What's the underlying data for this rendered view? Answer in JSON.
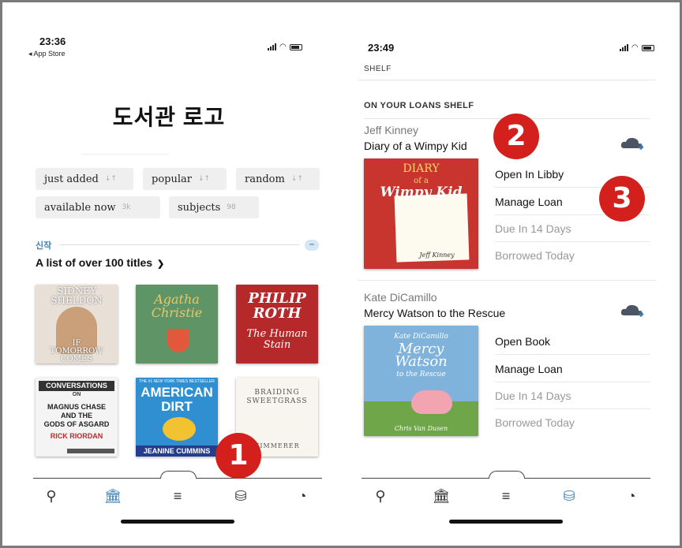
{
  "left_screen": {
    "status_bar": {
      "time": "23:36",
      "back_label": "◂ App Store"
    },
    "library_logo": "도서관 로고",
    "filter_chips": [
      {
        "label": "just added",
        "meta": "↓↑"
      },
      {
        "label": "popular",
        "meta": "↓↑"
      },
      {
        "label": "random",
        "meta": "↓↑"
      },
      {
        "label": "available now",
        "meta": "3k"
      },
      {
        "label": "subjects",
        "meta": "98"
      }
    ],
    "section": {
      "kicker": "신작",
      "collapse_symbol": "–",
      "title": "A list of over 100 titles",
      "title_chevron": "❯"
    },
    "covers": [
      {
        "lines": [
          "SIDNEY",
          "SHELDON"
        ],
        "footer": [
          "IF",
          "TOMORROW",
          "COMES"
        ],
        "bg": "#e8e0d6"
      },
      {
        "lines": [
          "Agatha",
          "Christie"
        ],
        "footer": [],
        "bg": "#5f9466"
      },
      {
        "lines": [
          "PHILIP",
          "ROTH"
        ],
        "footer": [
          "The Human",
          "Stain"
        ],
        "bg": "#b5292a"
      },
      {
        "lines": [
          "CONVERSATIONS",
          "ON"
        ],
        "footer": [
          "MAGNUS CHASE",
          "AND THE",
          "GODS OF ASGARD",
          "RICK RIORDAN"
        ],
        "bg": "#f4f4f4"
      },
      {
        "lines": [
          "THE #1 NEW YORK TIMES BESTSELLER",
          "AMERICAN",
          "DIRT"
        ],
        "footer": [
          "JEANINE CUMMINS"
        ],
        "bg": "#2f8fd1"
      },
      {
        "lines": [
          "BRAIDING",
          "SWEETGRASS"
        ],
        "footer": [
          "KIMMERER"
        ],
        "bg": "#f7f5ee"
      }
    ],
    "tabs": [
      {
        "name": "search",
        "glyph": "⚲"
      },
      {
        "name": "library",
        "glyph": "🏛"
      },
      {
        "name": "menu",
        "glyph": "≡"
      },
      {
        "name": "shelf",
        "glyph": "⛁"
      },
      {
        "name": "timeline",
        "glyph": "◔"
      }
    ],
    "step_badge": "1"
  },
  "right_screen": {
    "status_bar": {
      "time": "23:49"
    },
    "header": "SHELF",
    "loans_heading": "ON YOUR LOANS SHELF",
    "loans": [
      {
        "author": "Jeff Kinney",
        "title": "Diary of a Wimpy Kid",
        "cover": {
          "lines": [
            "DIARY",
            "of a",
            "Wimpy Kid"
          ],
          "footer": [
            "Jeff Kinney"
          ],
          "bg": "#c8352f"
        },
        "actions": [
          {
            "label": "Open In Libby",
            "style": "primary"
          },
          {
            "label": "Manage Loan",
            "style": "primary"
          },
          {
            "label": "Due In 14 Days",
            "style": "muted"
          },
          {
            "label": "Borrowed Today",
            "style": "muted"
          }
        ]
      },
      {
        "author": "Kate DiCamillo",
        "title": "Mercy Watson to the Rescue",
        "cover": {
          "lines": [
            "Kate DiCamillo",
            "Mercy",
            "Watson",
            "to the Rescue"
          ],
          "footer": [
            "Chris Van Dusen"
          ],
          "bg": "#7fb3db"
        },
        "actions": [
          {
            "label": "Open Book",
            "style": "primary"
          },
          {
            "label": "Manage Loan",
            "style": "primary"
          },
          {
            "label": "Due In 14 Days",
            "style": "muted"
          },
          {
            "label": "Borrowed Today",
            "style": "muted"
          }
        ]
      }
    ],
    "tabs": [
      {
        "name": "search",
        "glyph": "⚲"
      },
      {
        "name": "library",
        "glyph": "🏛"
      },
      {
        "name": "menu",
        "glyph": "≡"
      },
      {
        "name": "shelf",
        "glyph": "⛁"
      },
      {
        "name": "timeline",
        "glyph": "◔"
      }
    ],
    "step_badges": [
      "2",
      "3"
    ]
  },
  "colors": {
    "accent_blue": "#3a80b9",
    "badge_red": "#d3201d",
    "shelf_tab_active": "#3a80b9",
    "frame_border": "#7a7a7a"
  }
}
